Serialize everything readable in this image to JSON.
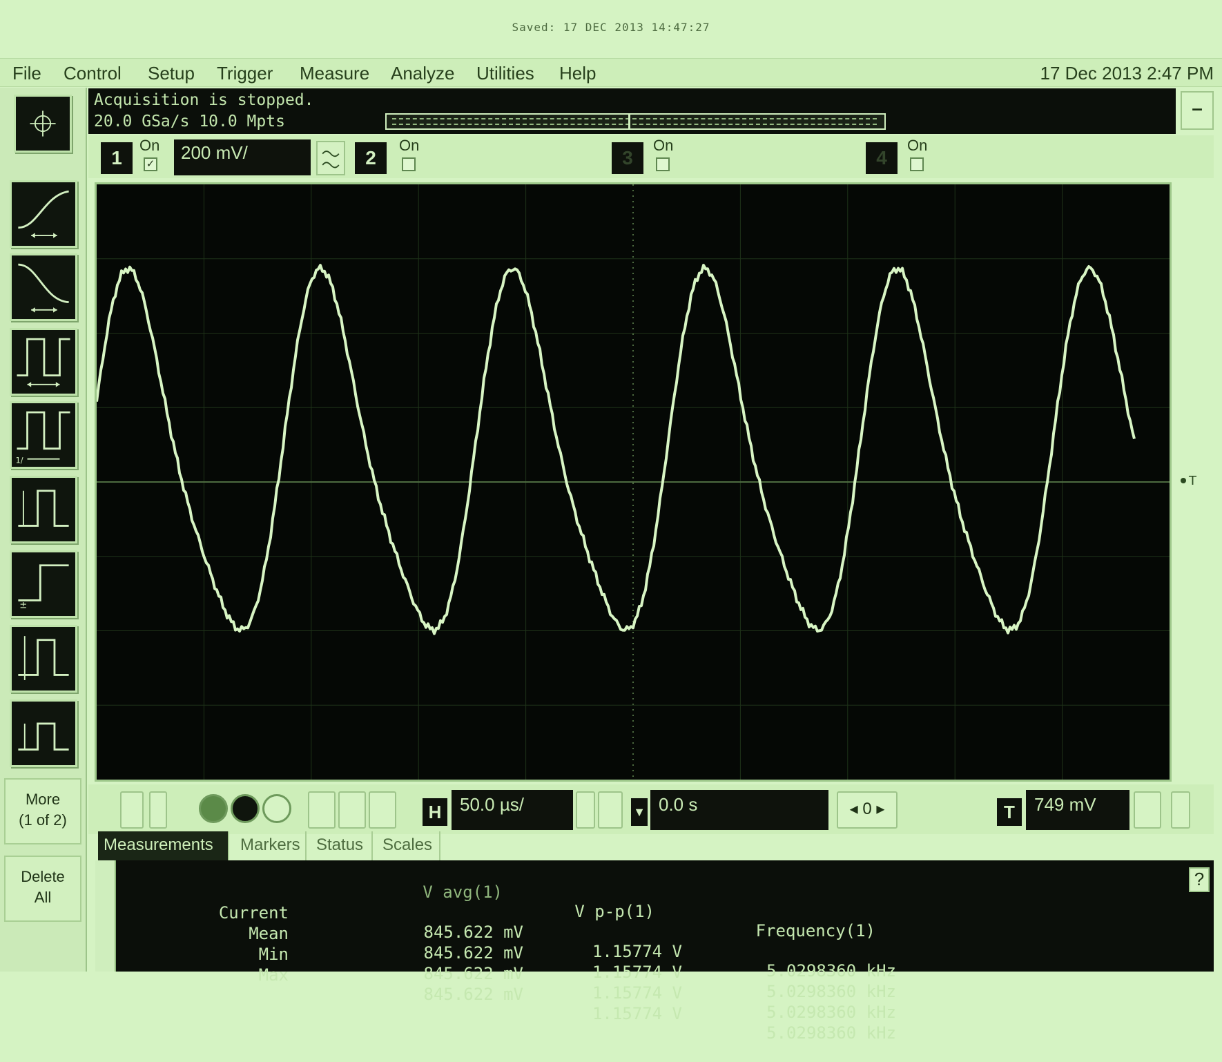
{
  "saved_banner": "Saved: 17 DEC 2013 14:47:27",
  "menu": {
    "items": [
      "File",
      "Control",
      "Setup",
      "Trigger",
      "Measure",
      "Analyze",
      "Utilities",
      "Help"
    ],
    "datetime": "17 Dec 2013  2:47 PM"
  },
  "acquisition": {
    "status": "Acquisition is stopped.",
    "rate": "20.0 GSa/s    10.0 Mpts"
  },
  "channels": [
    {
      "number": "1",
      "on_label": "On",
      "checked": true,
      "scale": "200 mV/"
    },
    {
      "number": "2",
      "on_label": "On",
      "checked": false
    },
    {
      "number": "3",
      "on_label": "On",
      "checked": false
    },
    {
      "number": "4",
      "on_label": "On",
      "checked": false
    }
  ],
  "left_panel": {
    "more_label_line1": "More",
    "more_label_line2": "(1 of 2)",
    "delete_label_line1": "Delete",
    "delete_label_line2": "All",
    "tools": [
      "rise-time-icon",
      "fall-time-icon",
      "period-icon",
      "frequency-icon",
      "positive-width-icon",
      "negative-width-icon",
      "duty-cycle-icon",
      "amplitude-icon"
    ]
  },
  "horizontal": {
    "badge": "H",
    "scale": "50.0 µs/",
    "position": "0.0 s",
    "ref": "0"
  },
  "trigger": {
    "badge": "T",
    "level": "749 mV"
  },
  "tabs": [
    "Measurements",
    "Markers",
    "Status",
    "Scales"
  ],
  "measurements": {
    "headers": [
      "V avg(1)",
      "V p-p(1)",
      "Frequency(1)"
    ],
    "rows": [
      {
        "label": "Current",
        "vavg": "845.622 mV",
        "vpp": "1.15774 V",
        "freq": "5.0298360 kHz"
      },
      {
        "label": "Mean",
        "vavg": "845.622 mV",
        "vpp": "1.15774 V",
        "freq": "5.0298360 kHz"
      },
      {
        "label": "Min",
        "vavg": "845.622 mV",
        "vpp": "1.15774 V",
        "freq": "5.0298360 kHz"
      },
      {
        "label": "Max",
        "vavg": "845.622 mV",
        "vpp": "1.15774 V",
        "freq": "5.0298360 kHz"
      }
    ]
  },
  "waveform": {
    "cycles": 5.4,
    "color": "#d8f5c4"
  },
  "colors": {
    "screen_bg": "#050805",
    "trace": "#d8f5c4",
    "panel_bg": "#d5f3c3"
  }
}
